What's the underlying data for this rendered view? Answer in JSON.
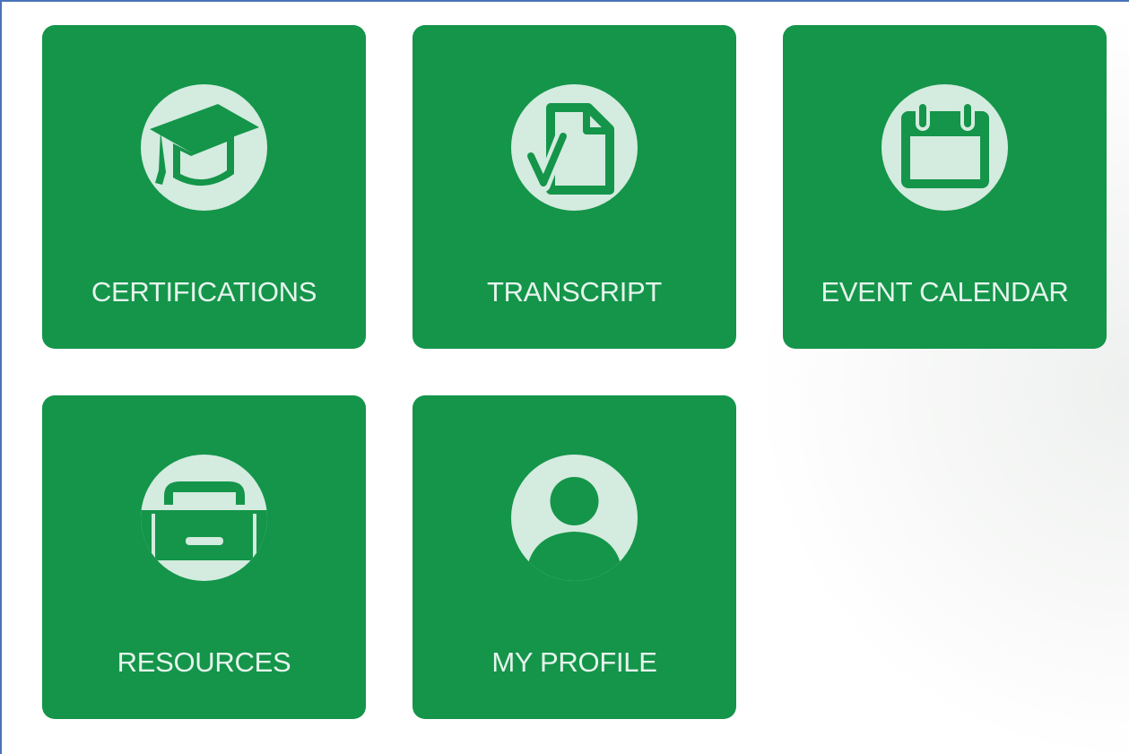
{
  "tiles": [
    {
      "label": "CERTIFICATIONS",
      "icon": "graduation-cap-icon"
    },
    {
      "label": "TRANSCRIPT",
      "icon": "document-check-icon"
    },
    {
      "label": "EVENT CALENDAR",
      "icon": "calendar-icon"
    },
    {
      "label": "RESOURCES",
      "icon": "file-drawer-icon"
    },
    {
      "label": "MY PROFILE",
      "icon": "user-icon"
    }
  ],
  "colors": {
    "tile_background": "#14954a",
    "icon_circle": "#d4ebdf",
    "label_text": "#e6f4ec",
    "frame_border": "#4a72b8"
  }
}
